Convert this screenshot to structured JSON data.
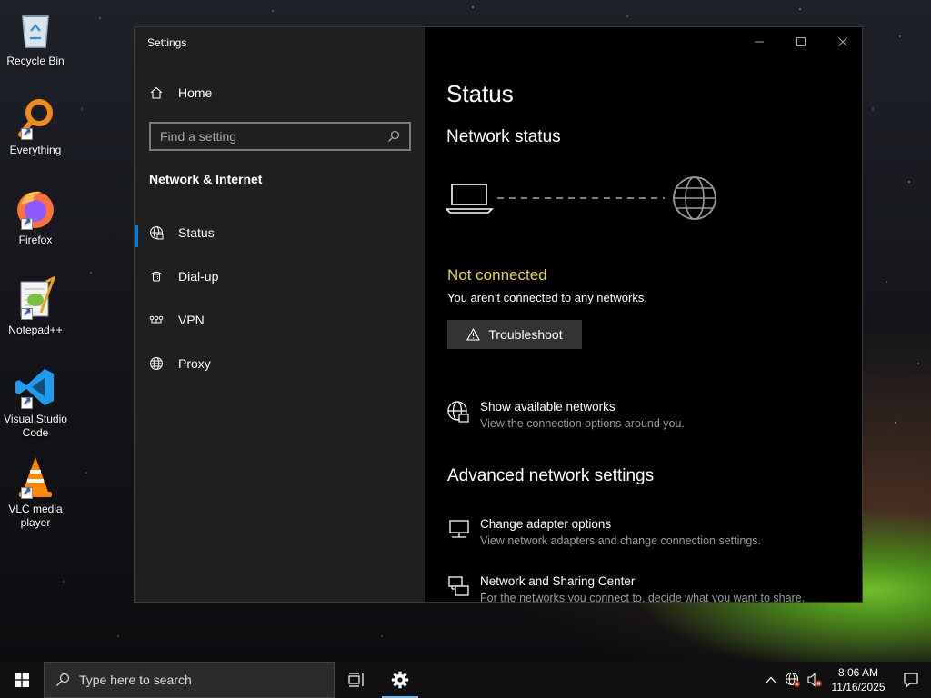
{
  "desktop": {
    "icons": [
      {
        "label": "Recycle Bin",
        "icon": "recycle-bin-icon"
      },
      {
        "label": "Everything",
        "icon": "everything-search-icon"
      },
      {
        "label": "Firefox",
        "icon": "firefox-icon"
      },
      {
        "label": "Notepad++",
        "icon": "notepad-plus-plus-icon"
      },
      {
        "label": "Visual Studio Code",
        "icon": "vscode-icon"
      },
      {
        "label": "VLC media player",
        "icon": "vlc-icon"
      }
    ]
  },
  "window": {
    "title": "Settings",
    "nav": {
      "home_label": "Home",
      "search_placeholder": "Find a setting",
      "section_title": "Network & Internet",
      "items": [
        {
          "label": "Status",
          "icon": "network-status-icon",
          "active": true
        },
        {
          "label": "Dial-up",
          "icon": "dial-up-icon",
          "active": false
        },
        {
          "label": "VPN",
          "icon": "vpn-icon",
          "active": false
        },
        {
          "label": "Proxy",
          "icon": "globe-icon",
          "active": false
        }
      ]
    },
    "content": {
      "page_title": "Status",
      "network_status_heading": "Network status",
      "connection_state": "Not connected",
      "connection_desc": "You aren’t connected to any networks.",
      "troubleshoot_label": "Troubleshoot",
      "show_networks": {
        "title": "Show available networks",
        "desc": "View the connection options around you."
      },
      "advanced_heading": "Advanced network settings",
      "change_adapter": {
        "title": "Change adapter options",
        "desc": "View network adapters and change connection settings."
      },
      "sharing_center": {
        "title": "Network and Sharing Center",
        "desc": "For the networks you connect to, decide what you want to share."
      }
    },
    "colors": {
      "accent": "#0a78d7",
      "warning": "#e8d44d"
    }
  },
  "taskbar": {
    "search_placeholder": "Type here to search",
    "time": "8:06 AM",
    "date": "11/16/2025"
  }
}
